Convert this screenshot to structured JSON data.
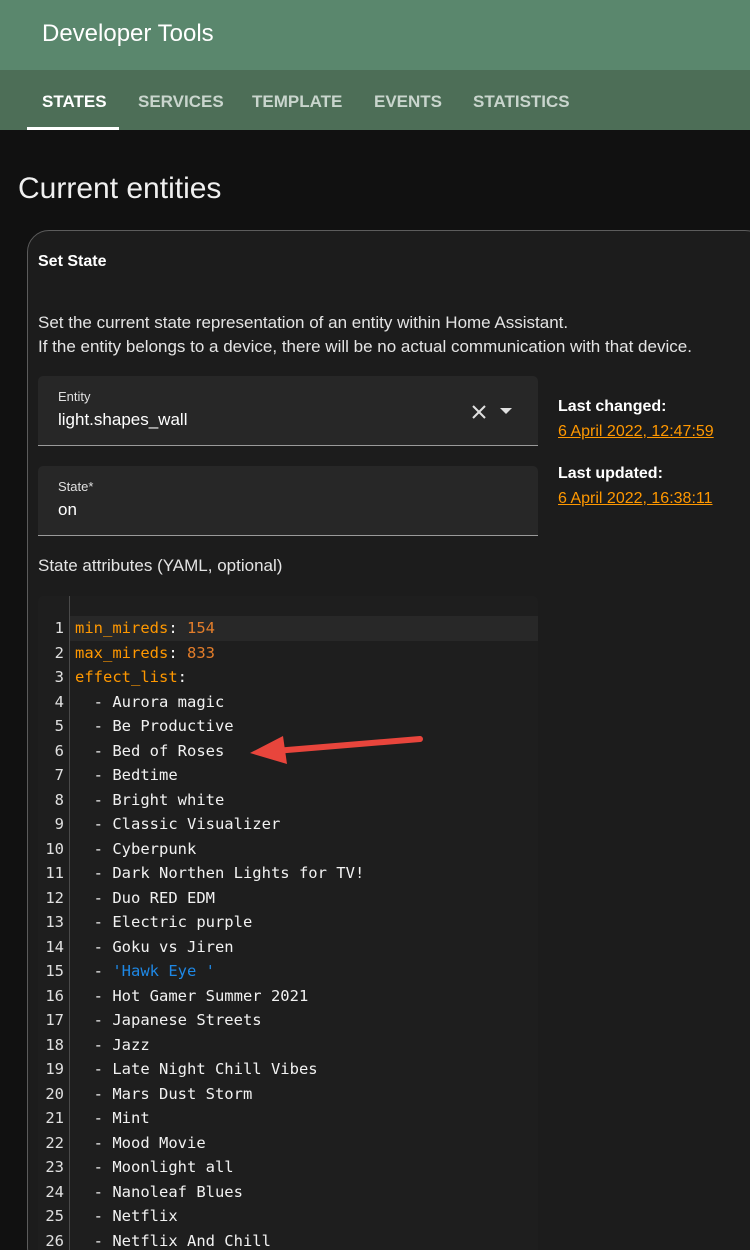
{
  "app": {
    "title": "Developer Tools"
  },
  "tabs": [
    {
      "label": "STATES",
      "active": true
    },
    {
      "label": "SERVICES",
      "active": false
    },
    {
      "label": "TEMPLATE",
      "active": false
    },
    {
      "label": "EVENTS",
      "active": false
    },
    {
      "label": "STATISTICS",
      "active": false
    }
  ],
  "page": {
    "heading": "Current entities"
  },
  "set_state": {
    "title": "Set State",
    "description": [
      "Set the current state representation of an entity within Home Assistant.",
      "If the entity belongs to a device, there will be no actual communication with that device."
    ],
    "entity": {
      "label": "Entity",
      "value": "light.shapes_wall"
    },
    "state": {
      "label": "State*",
      "value": "on"
    },
    "attributes_label": "State attributes (YAML, optional)"
  },
  "meta": {
    "last_changed_label": "Last changed:",
    "last_changed_value": "6 April 2022, 12:47:59",
    "last_updated_label": "Last updated:",
    "last_updated_value": "6 April 2022, 16:38:11"
  },
  "yaml": {
    "lines": [
      {
        "no": "1",
        "key": "min_mireds",
        "num": "154"
      },
      {
        "no": "2",
        "key": "max_mireds",
        "num": "833"
      },
      {
        "no": "3",
        "key": "effect_list"
      },
      {
        "no": "4",
        "item": "Aurora magic"
      },
      {
        "no": "5",
        "item": "Be Productive"
      },
      {
        "no": "6",
        "item": "Bed of Roses"
      },
      {
        "no": "7",
        "item": "Bedtime"
      },
      {
        "no": "8",
        "item": "Bright white"
      },
      {
        "no": "9",
        "item": "Classic Visualizer"
      },
      {
        "no": "10",
        "item": "Cyberpunk"
      },
      {
        "no": "11",
        "item": "Dark Northen Lights for TV!"
      },
      {
        "no": "12",
        "item": "Duo RED EDM"
      },
      {
        "no": "13",
        "item": "Electric purple"
      },
      {
        "no": "14",
        "item": "Goku vs Jiren"
      },
      {
        "no": "15",
        "item_quoted": "'Hawk Eye '"
      },
      {
        "no": "16",
        "item": "Hot Gamer Summer 2021"
      },
      {
        "no": "17",
        "item": "Japanese Streets"
      },
      {
        "no": "18",
        "item": "Jazz"
      },
      {
        "no": "19",
        "item": "Late Night Chill Vibes"
      },
      {
        "no": "20",
        "item": "Mars Dust Storm"
      },
      {
        "no": "21",
        "item": "Mint"
      },
      {
        "no": "22",
        "item": "Mood Movie"
      },
      {
        "no": "23",
        "item": "Moonlight all"
      },
      {
        "no": "24",
        "item": "Nanoleaf Blues"
      },
      {
        "no": "25",
        "item": "Netflix"
      },
      {
        "no": "26",
        "item": "Netflix And Chill"
      }
    ]
  },
  "colors": {
    "header": "#5a876d",
    "tabs": "#4d6e57",
    "link": "#ff9800",
    "yaml_key": "#ff9800",
    "yaml_number": "#e37d2a",
    "yaml_string": "#1e88e5",
    "arrow": "#e8453c"
  },
  "icons": {
    "clear": "close-icon",
    "dropdown": "menu-down-icon",
    "annotation": "red-arrow-annotation"
  }
}
